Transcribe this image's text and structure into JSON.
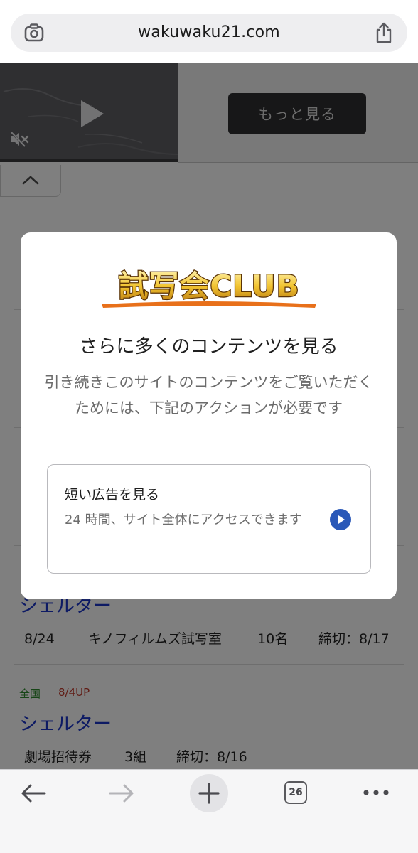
{
  "browser": {
    "url": "wakuwaku21.com",
    "tab_count": "26"
  },
  "ad": {
    "more_button": "もっと見る"
  },
  "listings": [
    {
      "title": "シェルター",
      "meta": [
        "8/24",
        "キノフィルムズ試写室",
        "10名",
        "締切：8/17"
      ]
    },
    {
      "region": "全国",
      "date_tag": "8/4UP",
      "title": "シェルター",
      "meta": [
        "劇場招待券",
        "3組",
        "締切：8/16"
      ]
    }
  ],
  "modal": {
    "logo_text": "試写会CLUB",
    "title": "さらに多くのコンテンツを見る",
    "description": "引き続きこのサイトのコンテンツをご覧いただくためには、下記のアクションが必要です",
    "option": {
      "title": "短い広告を見る",
      "description": "24 時間、サイト全体にアクセスできます"
    }
  },
  "colors": {
    "link_blue": "#1a35c8",
    "logo_orange": "#e8701a",
    "accent_blue": "#2a58b8"
  }
}
